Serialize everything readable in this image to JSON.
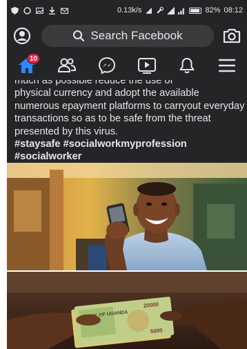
{
  "status_bar": {
    "network_speed": "0.13k/s",
    "battery": "82%",
    "time": "08:12"
  },
  "header": {
    "search_placeholder": "Search Facebook"
  },
  "nav": {
    "notifications_badge": "10",
    "items": [
      "home-icon",
      "friends-icon",
      "messenger-icon",
      "watch-icon",
      "notifications-icon",
      "menu-icon"
    ]
  },
  "post": {
    "cut_line": "much as possible reduce the use of",
    "body": "physical currency and adopt the available numerous epayment platforms to carryout everyday transactions so as to be safe from the threat presented by this virus.",
    "hashtags": "#staysafe #socialworkmyprofession #socialworker"
  },
  "photo_2": {
    "banknote_text": "BANK OF UGANDA",
    "banknote_value_1": "20000",
    "banknote_value_2": "5000"
  },
  "colors": {
    "bar_bg": "#242526",
    "search_bg": "#3a3b3c",
    "accent_blue": "#2d88ff",
    "badge_red": "#e41e3f"
  }
}
